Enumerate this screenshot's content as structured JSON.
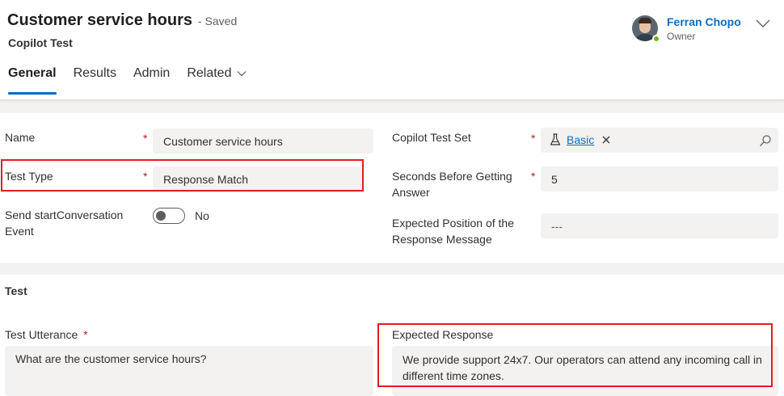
{
  "header": {
    "title": "Customer service hours",
    "save_status": "- Saved",
    "entity": "Copilot Test",
    "owner": {
      "name": "Ferran Chopo",
      "role": "Owner"
    }
  },
  "tabs": [
    {
      "label": "General",
      "active": true
    },
    {
      "label": "Results"
    },
    {
      "label": "Admin"
    },
    {
      "label": "Related"
    }
  ],
  "form": {
    "name": {
      "label": "Name",
      "value": "Customer service hours"
    },
    "test_type": {
      "label": "Test Type",
      "value": "Response Match"
    },
    "start_conversation": {
      "label_line1": "Send startConversation",
      "label_line2": "Event",
      "toggle_text": "No",
      "on": false
    },
    "test_set": {
      "label": "Copilot Test Set",
      "value": "Basic"
    },
    "seconds_before": {
      "label_line1": "Seconds Before Getting",
      "label_line2": "Answer",
      "value": "5"
    },
    "expected_position": {
      "label_line1": "Expected Position of the",
      "label_line2": "Response Message",
      "value": "---"
    }
  },
  "test_section": {
    "title": "Test",
    "utterance": {
      "label": "Test Utterance",
      "value": "What are the customer service hours?"
    },
    "expected_response": {
      "label": "Expected Response",
      "line1": "We provide support 24x7. Our operators can attend any incoming call in",
      "line2": "different time zones."
    }
  },
  "colors": {
    "accent": "#0f6cbd",
    "required": "#a4262c",
    "highlight": "#e31b23",
    "presence": "#6bb700"
  },
  "required_marker": "*",
  "icons": [
    "chevron-down-icon",
    "flask-icon",
    "close-icon",
    "search-icon"
  ]
}
